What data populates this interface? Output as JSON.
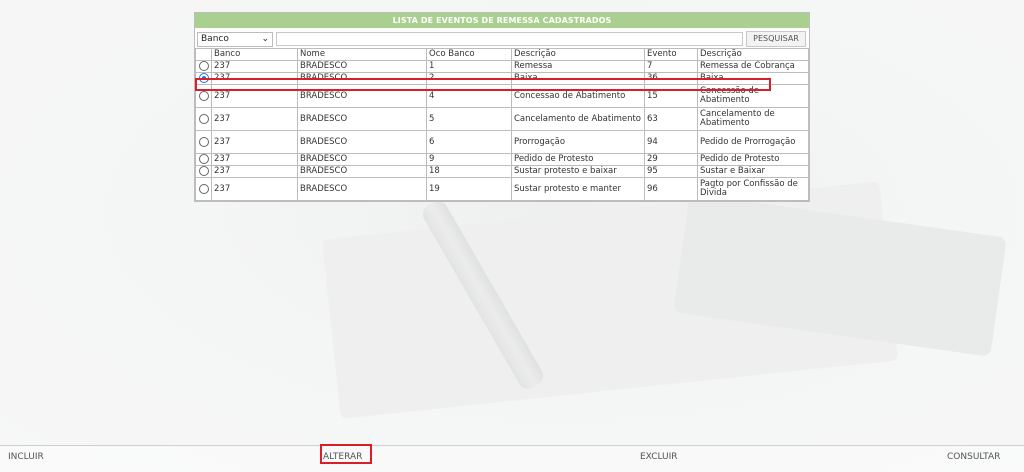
{
  "panel": {
    "title": "LISTA DE EVENTOS DE REMESSA CADASTRADOS",
    "filter_select": "Banco",
    "search_placeholder": "",
    "search_button": "PESQUISAR"
  },
  "table": {
    "headers": [
      "Banco",
      "Nome",
      "Oco Banco",
      "Descrição",
      "Evento",
      "Descrição"
    ],
    "rows": [
      {
        "selected": false,
        "cells": [
          "237",
          "BRADESCO",
          "1",
          "Remessa",
          "7",
          "Remessa de Cobrança"
        ]
      },
      {
        "selected": true,
        "cells": [
          "237",
          "BRADESCO",
          "2",
          "Baixa",
          "36",
          "Baixa"
        ]
      },
      {
        "selected": false,
        "cells": [
          "237",
          "BRADESCO",
          "4",
          "Concessao de Abatimento",
          "15",
          "Concessão de Abatimento"
        ]
      },
      {
        "selected": false,
        "cells": [
          "237",
          "BRADESCO",
          "5",
          "Cancelamento de Abatimento",
          "63",
          "Cancelamento de Abatimento"
        ]
      },
      {
        "selected": false,
        "cells": [
          "237",
          "BRADESCO",
          "6",
          "Prorrogação",
          "94",
          "Pedido de Prorrogação"
        ]
      },
      {
        "selected": false,
        "cells": [
          "237",
          "BRADESCO",
          "9",
          "Pedido de Protesto",
          "29",
          "Pedido de Protesto"
        ]
      },
      {
        "selected": false,
        "cells": [
          "237",
          "BRADESCO",
          "18",
          "Sustar protesto e baixar",
          "95",
          "Sustar e Baixar"
        ]
      },
      {
        "selected": false,
        "cells": [
          "237",
          "BRADESCO",
          "19",
          "Sustar protesto e manter",
          "96",
          "Pagto por Confissão de Divida"
        ]
      }
    ]
  },
  "footer": {
    "incluir": "INCLUIR",
    "alterar": "ALTERAR",
    "excluir": "EXCLUIR",
    "consultar": "CONSULTAR"
  },
  "colors": {
    "header_green": "#a9d08e",
    "highlight_red": "#d9202a",
    "radio_blue": "#1a73e8"
  }
}
